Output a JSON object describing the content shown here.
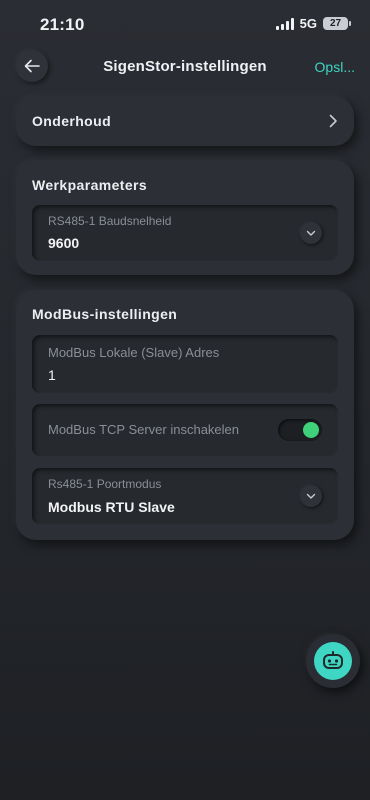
{
  "status_bar": {
    "time": "21:10",
    "network": "5G",
    "battery": "27",
    "icons": [
      "signal-icon",
      "battery-icon"
    ]
  },
  "header": {
    "title": "SigenStor-instellingen",
    "save_label": "Opsl...",
    "back_icon": "arrow-left-icon"
  },
  "maintenance": {
    "label": "Onderhoud",
    "icon": "chevron-right-icon"
  },
  "work_params": {
    "title": "Werkparameters",
    "baud": {
      "label": "RS485-1 Baudsnelheid",
      "value": "9600",
      "icon": "chevron-down-icon"
    }
  },
  "modbus": {
    "title": "ModBus-instellingen",
    "slave_address": {
      "label": "ModBus Lokale (Slave) Adres",
      "value": "1"
    },
    "tcp_server": {
      "label": "ModBus TCP Server inschakelen",
      "enabled": true
    },
    "port_mode": {
      "label": "Rs485-1 Poortmodus",
      "value": "Modbus RTU Slave",
      "icon": "chevron-down-icon"
    }
  },
  "assistant": {
    "icon": "robot-assistant-icon"
  },
  "colors": {
    "accent": "#3fd6c4",
    "toggle_on": "#3fd07a",
    "background": "#26292e",
    "card": "#2c2f35"
  }
}
